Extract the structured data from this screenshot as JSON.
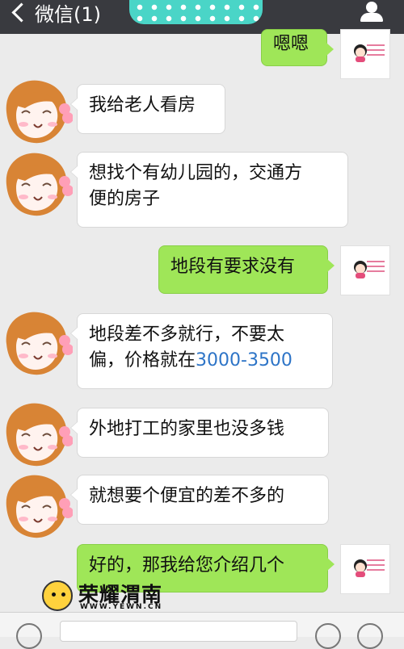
{
  "header": {
    "back_label": "微信(1)"
  },
  "messages": [
    {
      "side": "right",
      "text": "嗯嗯"
    },
    {
      "side": "left",
      "text": "我给老人看房"
    },
    {
      "side": "left",
      "lines": [
        "想找个有幼儿园的，交通方",
        "便的房子"
      ]
    },
    {
      "side": "right",
      "text": "地段有要求没有"
    },
    {
      "side": "left",
      "lines": [
        "地段差不多就行，不要太"
      ],
      "line2_prefix": "偏，价格就在",
      "line2_highlight": "3000-3500"
    },
    {
      "side": "left",
      "text": "外地打工的家里也没多钱"
    },
    {
      "side": "left",
      "text": "就想要个便宜的差不多的"
    },
    {
      "side": "right",
      "text": "好的，那我给您介绍几个"
    }
  ],
  "watermark": {
    "name": "荣耀渭南",
    "url": "WWW.YEWN.CN"
  },
  "icons": {
    "back": "back-arrow-icon",
    "profile": "profile-icon",
    "voice": "voice-icon",
    "emoji": "emoji-icon",
    "plus": "plus-icon"
  },
  "colors": {
    "header": "#393a3f",
    "chat_bg": "#ebebeb",
    "sent_bubble": "#9fe658",
    "received_bubble": "#ffffff",
    "price_highlight": "#2d74c7"
  }
}
